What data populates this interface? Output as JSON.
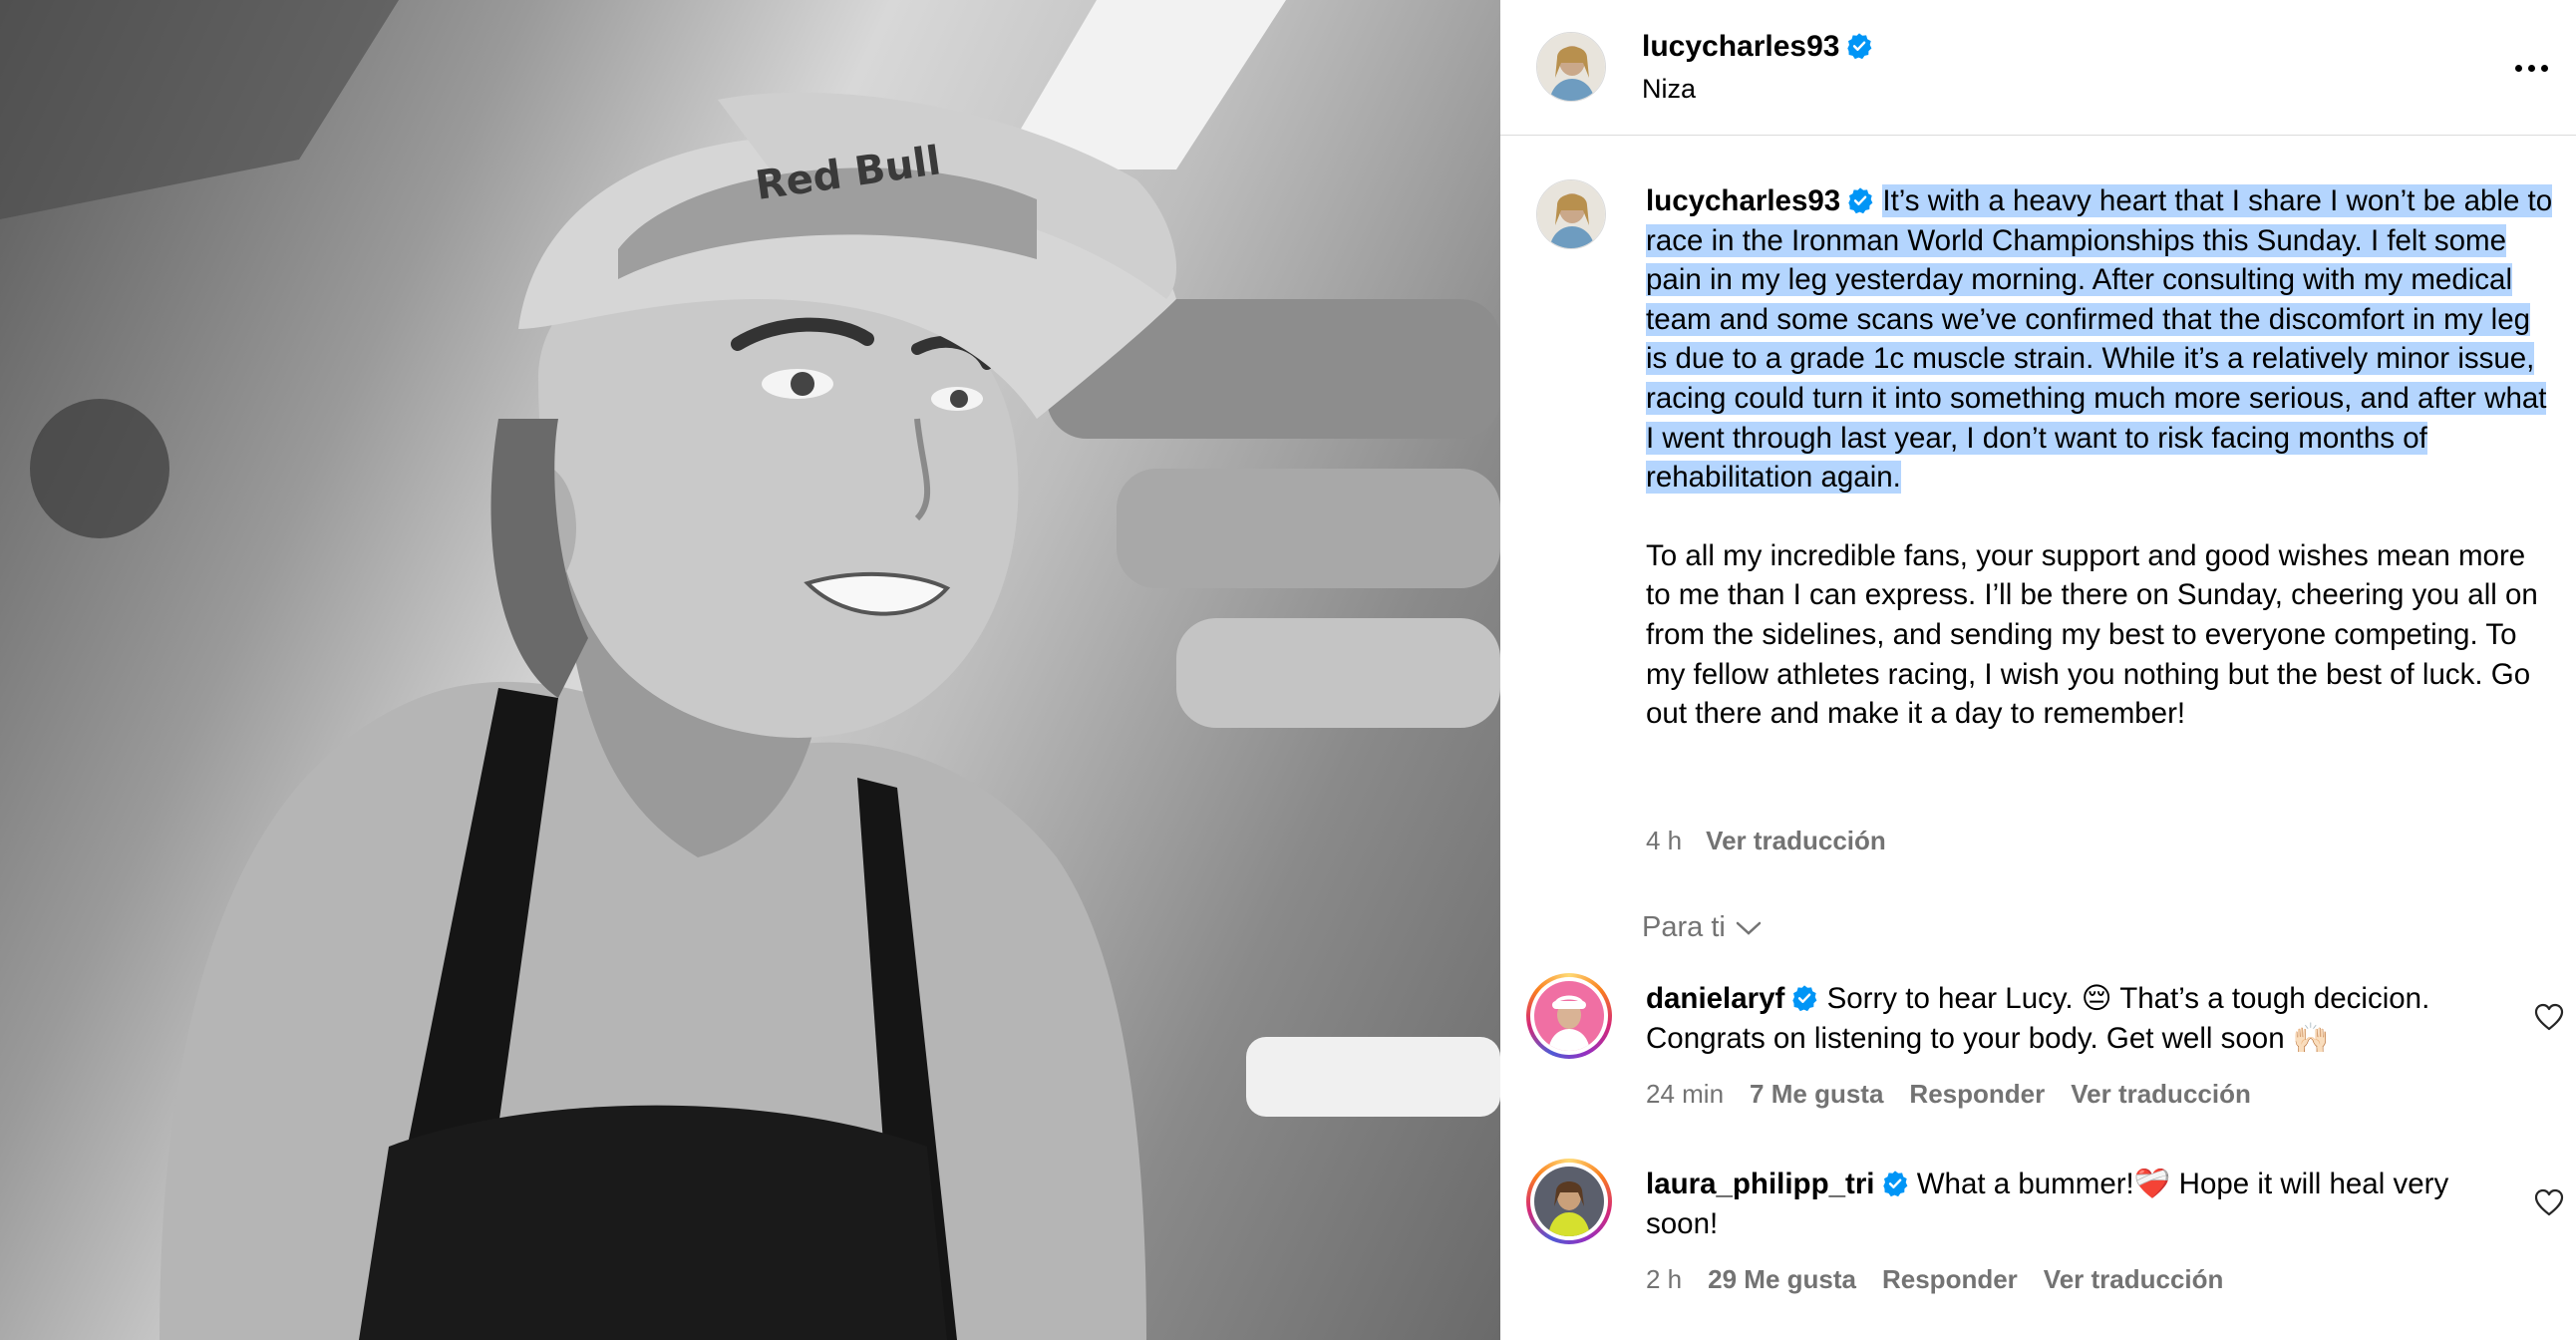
{
  "post": {
    "username": "lucycharles93",
    "location": "Niza",
    "photo_alt": "Black and white photo of athlete in Red Bull cap",
    "cap_logo_text": "Red Bull"
  },
  "caption": {
    "username": "lucycharles93",
    "highlighted_text": "It’s with a heavy heart that I share I won’t be able to race in the Ironman World Championships this Sunday. I felt some pain in my leg yesterday morning. After consulting with my medical team and some scans we’ve confirmed that the discomfort in my leg is due to a grade 1c muscle strain. While it’s a relatively minor issue, racing could turn it into something much more serious, and after what I went through last year, I don’t want to risk facing months of rehabilitation again.",
    "paragraph2": "To all my incredible fans, your support and good wishes mean more to me than I can express. I’ll be there on Sunday, cheering you all on from the sidelines, and sending my best to everyone competing. To my fellow athletes racing, I wish you nothing but the best of luck. Go out there and make it a day to remember!",
    "time": "4 h",
    "translate": "Ver traducción"
  },
  "filter_label": "Para ti",
  "comments": [
    {
      "username": "danielaryf",
      "text": "Sorry to hear Lucy. 😔 That’s a tough decicion. Congrats on listening to your body. Get well soon 🙌🏻",
      "time": "24 min",
      "likes": "7 Me gusta",
      "reply": "Responder",
      "translate": "Ver traducción"
    },
    {
      "username": "laura_philipp_tri",
      "text": "What a bummer!❤️‍🩹 Hope it will heal very soon!",
      "time": "2 h",
      "likes": "29 Me gusta",
      "reply": "Responder",
      "translate": "Ver traducción"
    }
  ],
  "colors": {
    "verified": "#0095f6",
    "secondary_text": "#737373",
    "selection": "#b4d5fe"
  },
  "icons": [
    "verified-badge-icon",
    "more-options-icon",
    "chevron-down-icon",
    "heart-icon"
  ]
}
